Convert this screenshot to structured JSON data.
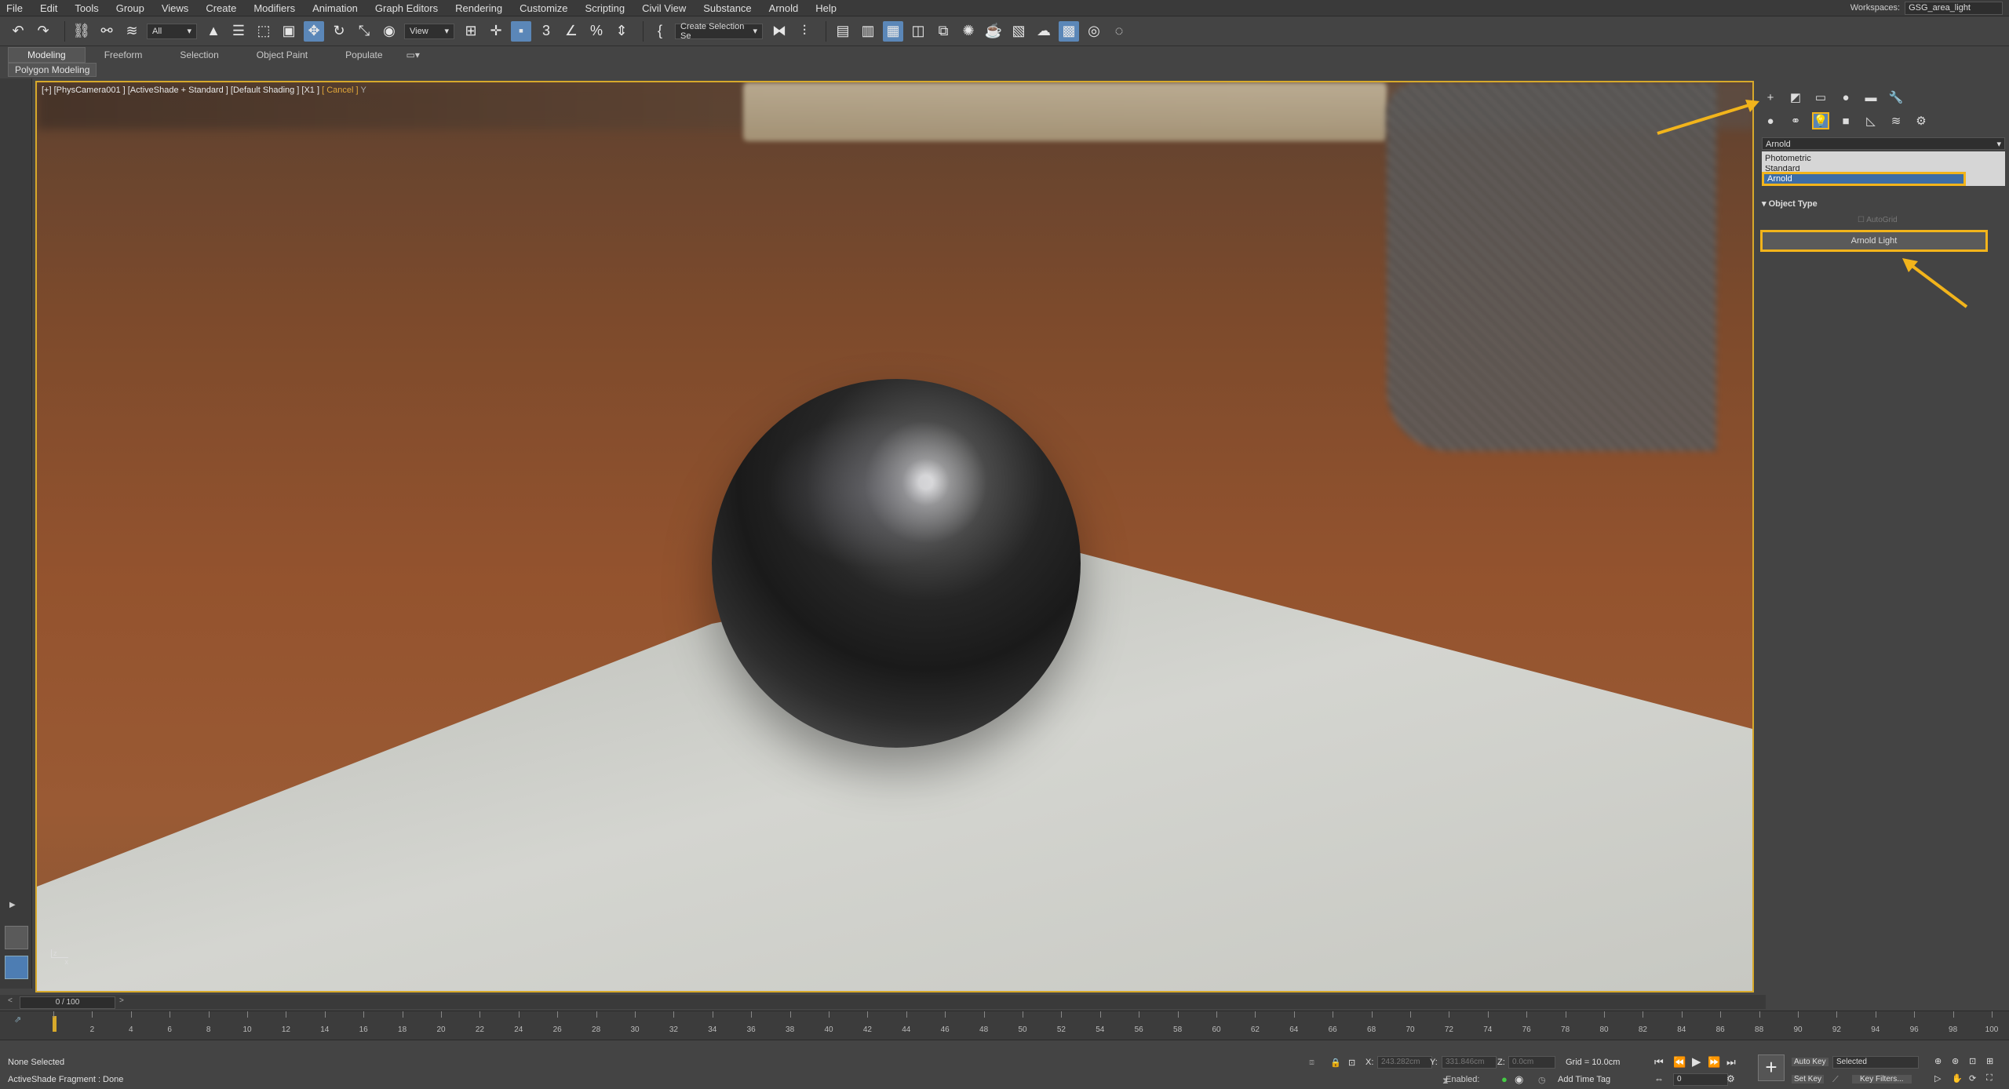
{
  "menubar": {
    "items": [
      "File",
      "Edit",
      "Tools",
      "Group",
      "Views",
      "Create",
      "Modifiers",
      "Animation",
      "Graph Editors",
      "Rendering",
      "Customize",
      "Scripting",
      "Civil View",
      "Substance",
      "Arnold",
      "Help"
    ]
  },
  "workspace": {
    "label": "Workspaces:",
    "value": "GSG_area_light"
  },
  "toolbar": {
    "filter_value": "All",
    "view_value": "View",
    "selection_set_placeholder": "Create Selection Se"
  },
  "ribbon": {
    "tabs": [
      "Modeling",
      "Freeform",
      "Selection",
      "Object Paint",
      "Populate"
    ],
    "sub_label": "Polygon Modeling"
  },
  "viewport": {
    "label_main": "[+] [PhysCamera001 ] [ActiveShade + Standard ] [Default Shading ] [X1 ]",
    "label_cancel": "[ Cancel ]",
    "label_y": "Y",
    "axis_z": "z",
    "axis_x": "x"
  },
  "command_panel": {
    "category_value": "Arnold",
    "list_items": [
      "Photometric",
      "Standard",
      "Arnold"
    ],
    "rollout_title": "Object Type",
    "autogrid_label": "AutoGrid",
    "button_label": "Arnold Light"
  },
  "timeline": {
    "frame_display": "0 / 100",
    "ticks": [
      "0",
      "2",
      "4",
      "6",
      "8",
      "10",
      "12",
      "14",
      "16",
      "18",
      "20",
      "22",
      "24",
      "26",
      "28",
      "30",
      "32",
      "34",
      "36",
      "38",
      "40",
      "42",
      "44",
      "46",
      "48",
      "50",
      "52",
      "54",
      "56",
      "58",
      "60",
      "62",
      "64",
      "66",
      "68",
      "70",
      "72",
      "74",
      "76",
      "78",
      "80",
      "82",
      "84",
      "86",
      "88",
      "90",
      "92",
      "94",
      "96",
      "98",
      "100"
    ]
  },
  "status": {
    "selection_text": "None Selected",
    "prompt_text": "ActiveShade Fragment : Done",
    "x_label": "X:",
    "x_value": "243.282cm",
    "y_label": "Y:",
    "y_value": "331.846cm",
    "z_label": "Z:",
    "z_value": "0.0cm",
    "grid_text": "Grid = 10.0cm",
    "enabled_label": "Enabled:",
    "add_time_tag": "Add Time Tag",
    "auto_key": "Auto Key",
    "set_key": "Set Key",
    "selected_value": "Selected",
    "key_filters": "Key Filters...",
    "frame_value": "0"
  },
  "colors": {
    "accent": "#f2b41b",
    "selection_blue": "#3d6da6"
  }
}
